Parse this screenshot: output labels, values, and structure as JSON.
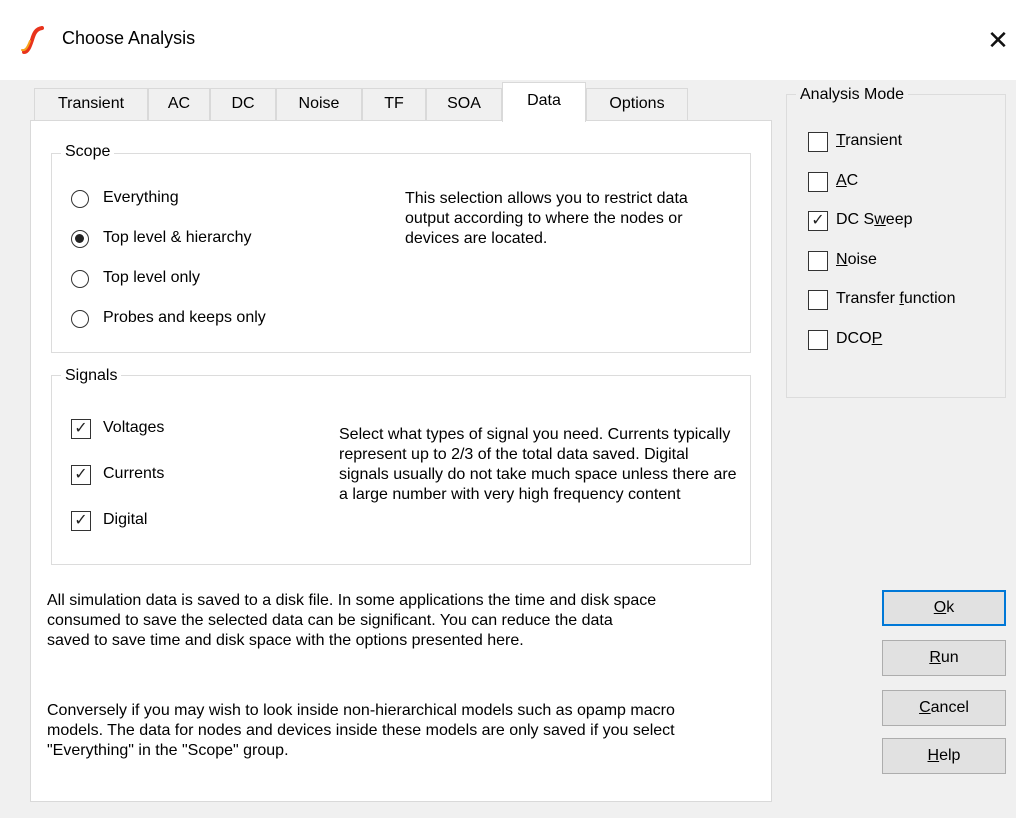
{
  "window": {
    "title": "Choose Analysis",
    "close_glyph": "✕",
    "app_icon": "simetrix-logo-icon",
    "accent_color": "#e8331c"
  },
  "tabs": [
    {
      "label": "Transient",
      "active": false
    },
    {
      "label": "AC",
      "active": false
    },
    {
      "label": "DC",
      "active": false
    },
    {
      "label": "Noise",
      "active": false
    },
    {
      "label": "TF",
      "active": false
    },
    {
      "label": "SOA",
      "active": false
    },
    {
      "label": "Data",
      "active": true
    },
    {
      "label": "Options",
      "active": false
    }
  ],
  "scope": {
    "caption": "Scope",
    "options": [
      {
        "label": "Everything",
        "checked": false
      },
      {
        "label": "Top level & hierarchy",
        "checked": true
      },
      {
        "label": "Top level only",
        "checked": false
      },
      {
        "label": "Probes and keeps only",
        "checked": false
      }
    ],
    "description": "This selection allows you to restrict data output according to where the nodes or devices are located."
  },
  "signals": {
    "caption": "Signals",
    "options": [
      {
        "label": "Voltages",
        "checked": true
      },
      {
        "label": "Currents",
        "checked": true
      },
      {
        "label": "Digital",
        "checked": true
      }
    ],
    "description": "Select what types of signal you need. Currents typically represent up to 2/3 of the total data saved. Digital signals usually do not take much space unless there are a large number with very high frequency content"
  },
  "info": {
    "paragraph1": "All simulation data is saved to a disk file. In some applications the time and disk space consumed to save the selected data can be significant. You can reduce the data saved to save time and disk space with the options presented here.",
    "paragraph2": "Conversely if you may wish to look inside non-hierarchical models such as opamp macro models. The data for nodes and devices inside these models are only saved if you select \"Everything\" in the \"Scope\" group."
  },
  "analysis_mode": {
    "caption": "Analysis Mode",
    "items": [
      {
        "label": "Transient",
        "checked": false
      },
      {
        "label": "AC",
        "checked": false
      },
      {
        "label": "DC Sweep",
        "checked": true
      },
      {
        "label": "Noise",
        "checked": false
      },
      {
        "label": "Transfer function",
        "checked": false
      },
      {
        "label": "DCOP",
        "checked": false
      }
    ]
  },
  "buttons": {
    "ok": "Ok",
    "run": "Run",
    "cancel": "Cancel",
    "help": "Help"
  },
  "check_glyph": "✓"
}
